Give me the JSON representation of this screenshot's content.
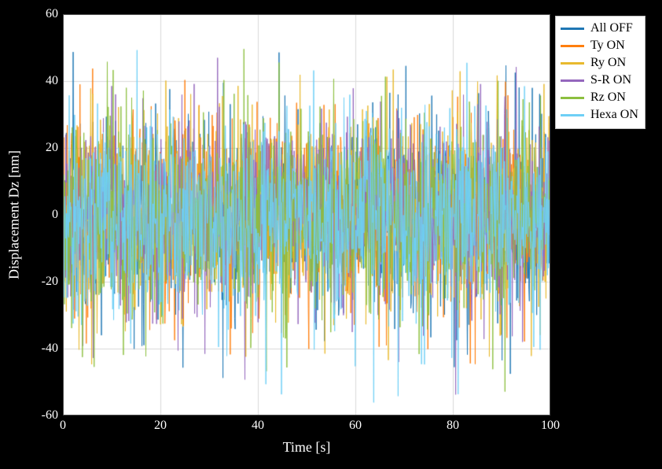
{
  "chart_data": {
    "type": "line",
    "title": "",
    "xlabel": "Time [s]",
    "ylabel": "Displacement Dz [nm]",
    "xlim": [
      0,
      100
    ],
    "ylim": [
      -60,
      60
    ],
    "xticks": [
      0,
      20,
      40,
      60,
      80,
      100
    ],
    "yticks": [
      -60,
      -40,
      -20,
      0,
      20,
      40,
      60
    ],
    "grid": true,
    "legend_position": "upper right (outside)",
    "note": "Dense noise-like time series; per-sample values not individually readable. Series share approximately zero mean with peak-to-peak roughly ±40 nm and occasional spikes to about ±55 nm.",
    "n_points": 1000,
    "series": [
      {
        "name": "All OFF",
        "color": "#1f77b4",
        "std": 14,
        "spike_prob": 0.015,
        "spike_mag": 50
      },
      {
        "name": "Ty ON",
        "color": "#ff7f0e",
        "std": 14,
        "spike_prob": 0.015,
        "spike_mag": 45
      },
      {
        "name": "Ry ON",
        "color": "#e8b92e",
        "std": 14,
        "spike_prob": 0.012,
        "spike_mag": 45
      },
      {
        "name": "S-R ON",
        "color": "#9467bd",
        "std": 14,
        "spike_prob": 0.012,
        "spike_mag": 45
      },
      {
        "name": "Rz ON",
        "color": "#8cbf3f",
        "std": 14,
        "spike_prob": 0.012,
        "spike_mag": 48
      },
      {
        "name": "Hexa ON",
        "color": "#6ecff6",
        "std": 14,
        "spike_prob": 0.015,
        "spike_mag": 55
      }
    ]
  }
}
